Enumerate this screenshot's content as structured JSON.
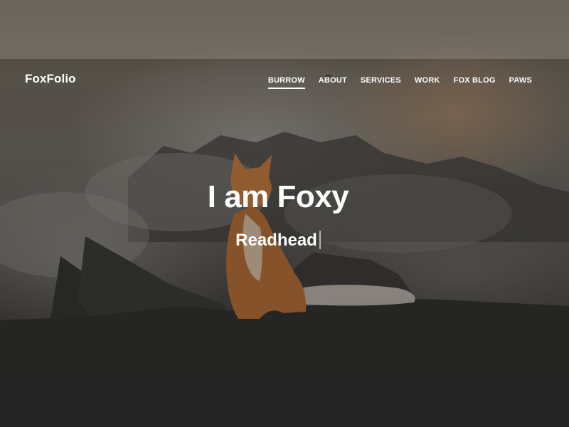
{
  "site": {
    "logo": "FoxFolio"
  },
  "nav": {
    "items": [
      {
        "label": "BURROW",
        "active": true
      },
      {
        "label": "ABOUT",
        "active": false
      },
      {
        "label": "SERVICES",
        "active": false
      },
      {
        "label": "WORK",
        "active": false
      },
      {
        "label": "FOX BLOG",
        "active": false
      },
      {
        "label": "PAWS",
        "active": false
      }
    ]
  },
  "hero": {
    "title": "I am Foxy",
    "subtitle": "Readhead"
  },
  "colors": {
    "text": "#ffffff",
    "fox": "#c0763a"
  }
}
